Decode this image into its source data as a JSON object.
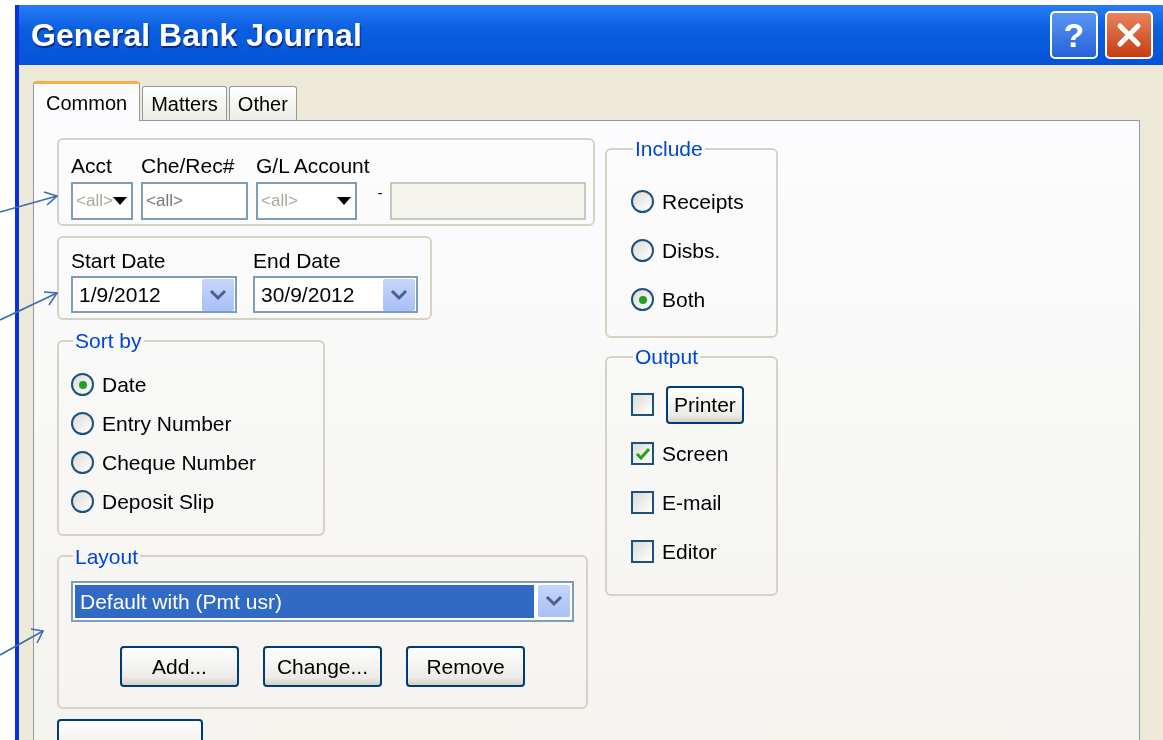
{
  "window": {
    "title": "General Bank Journal",
    "help_button": "?"
  },
  "tabs": [
    {
      "label": "Common",
      "selected": true
    },
    {
      "label": "Matters",
      "selected": false
    },
    {
      "label": "Other",
      "selected": false
    }
  ],
  "filter": {
    "fields": [
      {
        "label": "Acct",
        "kind": "combo",
        "placeholder": "<all>"
      },
      {
        "label": "Che/Rec#",
        "kind": "text",
        "placeholder": "<all>"
      },
      {
        "label": "G/L Account",
        "kind": "combo",
        "placeholder": "<all>"
      }
    ],
    "separator": "-"
  },
  "dates": [
    {
      "label": "Start Date",
      "value": "1/9/2012"
    },
    {
      "label": "End Date",
      "value": "30/9/2012"
    }
  ],
  "sort_by": {
    "title": "Sort by",
    "options": [
      {
        "label": "Date",
        "selected": true
      },
      {
        "label": "Entry Number",
        "selected": false
      },
      {
        "label": "Cheque Number",
        "selected": false
      },
      {
        "label": "Deposit Slip",
        "selected": false
      }
    ]
  },
  "layout": {
    "title": "Layout",
    "value": "Default with (Pmt usr)",
    "buttons": [
      "Add...",
      "Change...",
      "Remove"
    ]
  },
  "include": {
    "title": "Include",
    "options": [
      {
        "label": "Receipts",
        "selected": false
      },
      {
        "label": "Disbs.",
        "selected": false
      },
      {
        "label": "Both",
        "selected": true
      }
    ]
  },
  "output": {
    "title": "Output",
    "options": [
      {
        "label": "Printer",
        "kind": "button",
        "checked": false
      },
      {
        "label": "Screen",
        "kind": "label",
        "checked": true
      },
      {
        "label": "E-mail",
        "kind": "label",
        "checked": false
      },
      {
        "label": "Editor",
        "kind": "label",
        "checked": false
      }
    ]
  }
}
